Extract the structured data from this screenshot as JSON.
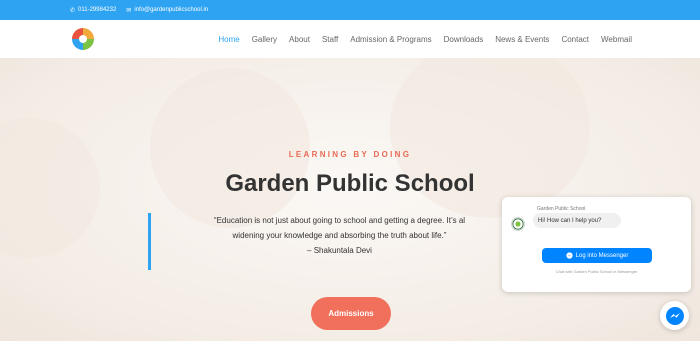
{
  "topbar": {
    "phone": "011-29984232",
    "email": "info@gardenpublicschool.in"
  },
  "nav": {
    "items": [
      {
        "label": "Home"
      },
      {
        "label": "Gallery"
      },
      {
        "label": "About"
      },
      {
        "label": "Staff"
      },
      {
        "label": "Admission & Programs"
      },
      {
        "label": "Downloads"
      },
      {
        "label": "News & Events"
      },
      {
        "label": "Contact"
      },
      {
        "label": "Webmail"
      }
    ],
    "active": "Home"
  },
  "hero": {
    "tagline": "LEARNING BY DOING",
    "title": "Garden Public School",
    "quote_line1": "“Education is not just about going to school and getting a degree. It’s al",
    "quote_line2": "widening  your knowledge and absorbing the truth about life.”",
    "quote_author": "– Shakuntala Devi",
    "button_label": "Admissions"
  },
  "chat": {
    "page_name": "Garden Public School",
    "greeting": "Hi! How can I help you?",
    "login_label": "Log into Messenger",
    "sub_text": "Chat with Garden Public School in Messenger"
  },
  "colors": {
    "accent": "#2ea3f2",
    "tagline": "#e86b55",
    "button": "#f0705c",
    "messenger": "#0084ff"
  },
  "icons": {
    "phone": "phone-icon",
    "email": "email-icon",
    "messenger": "messenger-icon"
  }
}
